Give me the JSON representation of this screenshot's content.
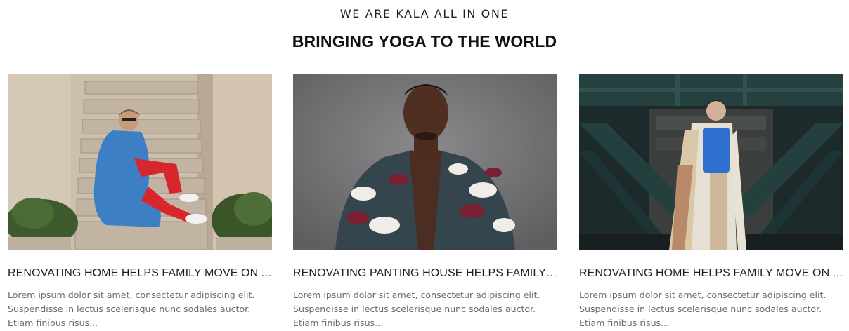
{
  "section": {
    "eyebrow": "WE ARE KALA ALL IN ONE",
    "heading": "BRINGING YOGA TO THE WORLD"
  },
  "posts": [
    {
      "title": "RENOVATING HOME HELPS FAMILY MOVE ON AFT...",
      "excerpt_lines": [
        "Lorem ipsum dolor sit amet, consectetur adipiscing elit.",
        "Suspendisse in lectus scelerisque nunc sodales auctor.",
        "Etiam finibus risus..."
      ],
      "image": "woman-blue-coat-on-stairs-photo"
    },
    {
      "title": "RENOVATING PANTING HOUSE HELPS FAMILY MO...",
      "excerpt_lines": [
        "Lorem ipsum dolor sit amet, consectetur adipiscing elit.",
        "Suspendisse in lectus scelerisque nunc sodales auctor.",
        "Etiam finibus risus..."
      ],
      "image": "man-camo-shirt-portrait-photo"
    },
    {
      "title": "RENOVATING HOME HELPS FAMILY MOVE ON AFT...",
      "excerpt_lines": [
        "Lorem ipsum dolor sit amet, consectetur adipiscing elit.",
        "Suspendisse in lectus scelerisque nunc sodales auctor.",
        "Etiam finibus risus..."
      ],
      "image": "man-under-bridge-photo"
    }
  ],
  "colors": {
    "heading": "#111111",
    "text": "#222222",
    "excerpt": "#6b6b6b"
  }
}
